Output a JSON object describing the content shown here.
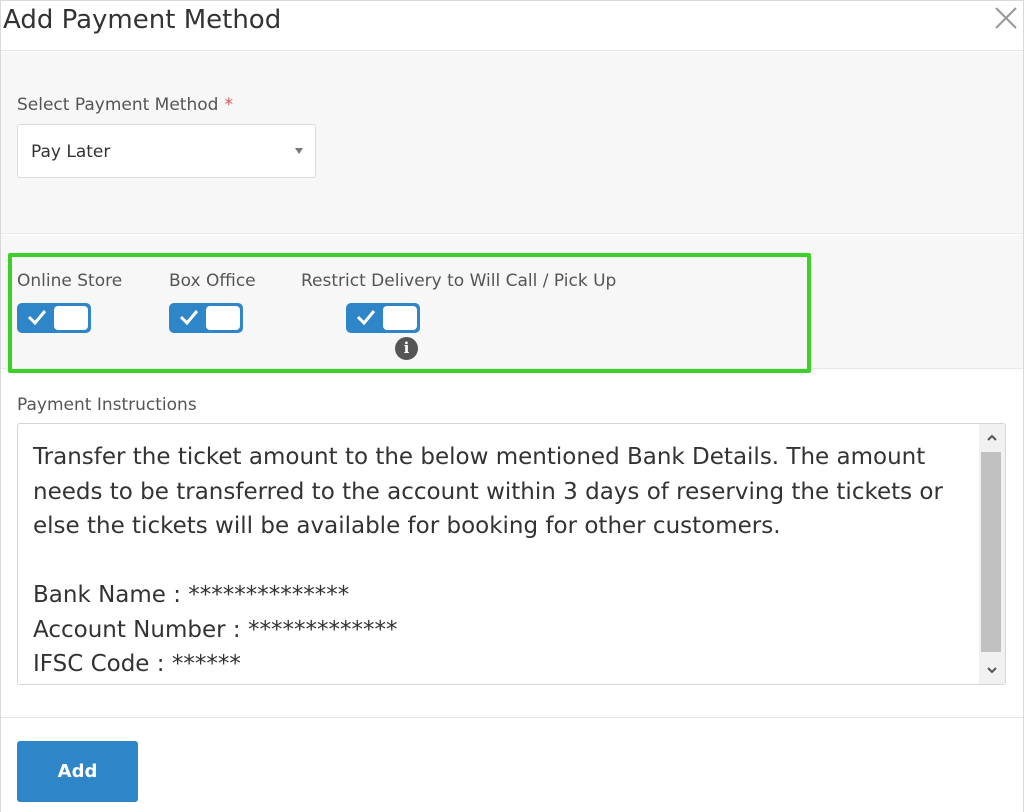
{
  "dialog": {
    "title": "Add Payment Method"
  },
  "payment_method": {
    "label": "Select Payment Method",
    "required_mark": "*",
    "selected_value": "Pay Later"
  },
  "toggles": [
    {
      "label": "Online Store",
      "enabled": true
    },
    {
      "label": "Box Office",
      "enabled": true
    },
    {
      "label": "Restrict Delivery to Will Call / Pick Up",
      "enabled": true
    }
  ],
  "info_icon": {
    "glyph": "i"
  },
  "instructions": {
    "label": "Payment Instructions",
    "text": "Transfer the ticket amount to the below mentioned Bank Details. The amount needs to be transferred to the account within 3 days of reserving the tickets or else the tickets will be available for booking for other customers.\n\nBank Name : **************\nAccount Number : *************\nIFSC Code : ******"
  },
  "footer": {
    "add_label": "Add"
  },
  "colors": {
    "accent": "#2e85c8",
    "highlight": "#3fcf2a",
    "required": "#d9534f"
  },
  "icons": {
    "close": "close-icon",
    "caret": "chevron-down-icon",
    "check": "check-icon",
    "info": "info-icon"
  }
}
